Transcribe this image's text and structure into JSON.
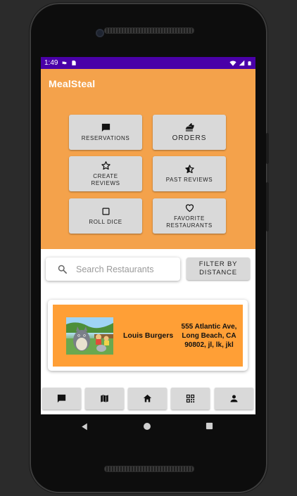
{
  "status_bar": {
    "time": "1:49",
    "icons": [
      "gear-icon",
      "sd-card-icon",
      "wifi-icon",
      "signal-icon",
      "battery-icon"
    ]
  },
  "app_bar": {
    "title": "MealSteal"
  },
  "menu": {
    "reservations": "Reservations",
    "orders": "Orders",
    "create_reviews": "Create Reviews",
    "past_reviews": "Past Reviews",
    "roll_dice": "Roll Dice",
    "favorite_restaurants": "Favorite Restaurants"
  },
  "search": {
    "placeholder": "Search Restaurants",
    "value": ""
  },
  "filter": {
    "label": "Filter by Distance"
  },
  "restaurants": [
    {
      "name": "Louis Burgers",
      "address": "555 Atlantic Ave, Long Beach, CA 90802, jl, lk, jkl"
    }
  ],
  "bottom_nav": [
    "chat-icon",
    "map-icon",
    "home-icon",
    "qr-code-icon",
    "person-icon"
  ],
  "colors": {
    "accent": "#f4a24b",
    "status_bar": "#4a00a8",
    "card": "#ff9f36",
    "button": "#d9d9d9"
  }
}
